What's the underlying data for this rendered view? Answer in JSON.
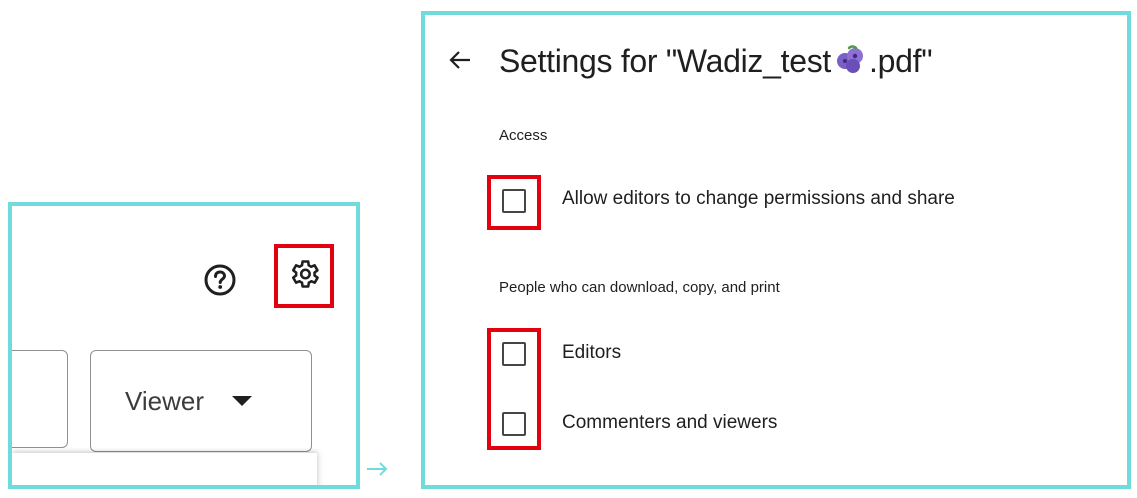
{
  "left_panel": {
    "help_icon": "help-circle-icon",
    "settings_icon": "gear-icon",
    "role_select": {
      "value": "Viewer",
      "icon": "caret-down-icon"
    }
  },
  "arrow_icon": "right-arrow-icon",
  "right_panel": {
    "back_icon": "back-arrow-icon",
    "title_prefix": "Settings for \"Wadiz_test",
    "title_suffix": ".pdf\"",
    "title_emoji": "blueberries-emoji",
    "access": {
      "label": "Access",
      "options": [
        {
          "label": "Allow editors to change permissions and share",
          "checked": false
        }
      ]
    },
    "download": {
      "label": "People who can download, copy, and print",
      "options": [
        {
          "label": "Editors",
          "checked": false
        },
        {
          "label": "Commenters and viewers",
          "checked": false
        }
      ]
    }
  },
  "colors": {
    "frame": "#6fdbdc",
    "highlight": "#e3000f",
    "text": "#1f1f1f"
  }
}
